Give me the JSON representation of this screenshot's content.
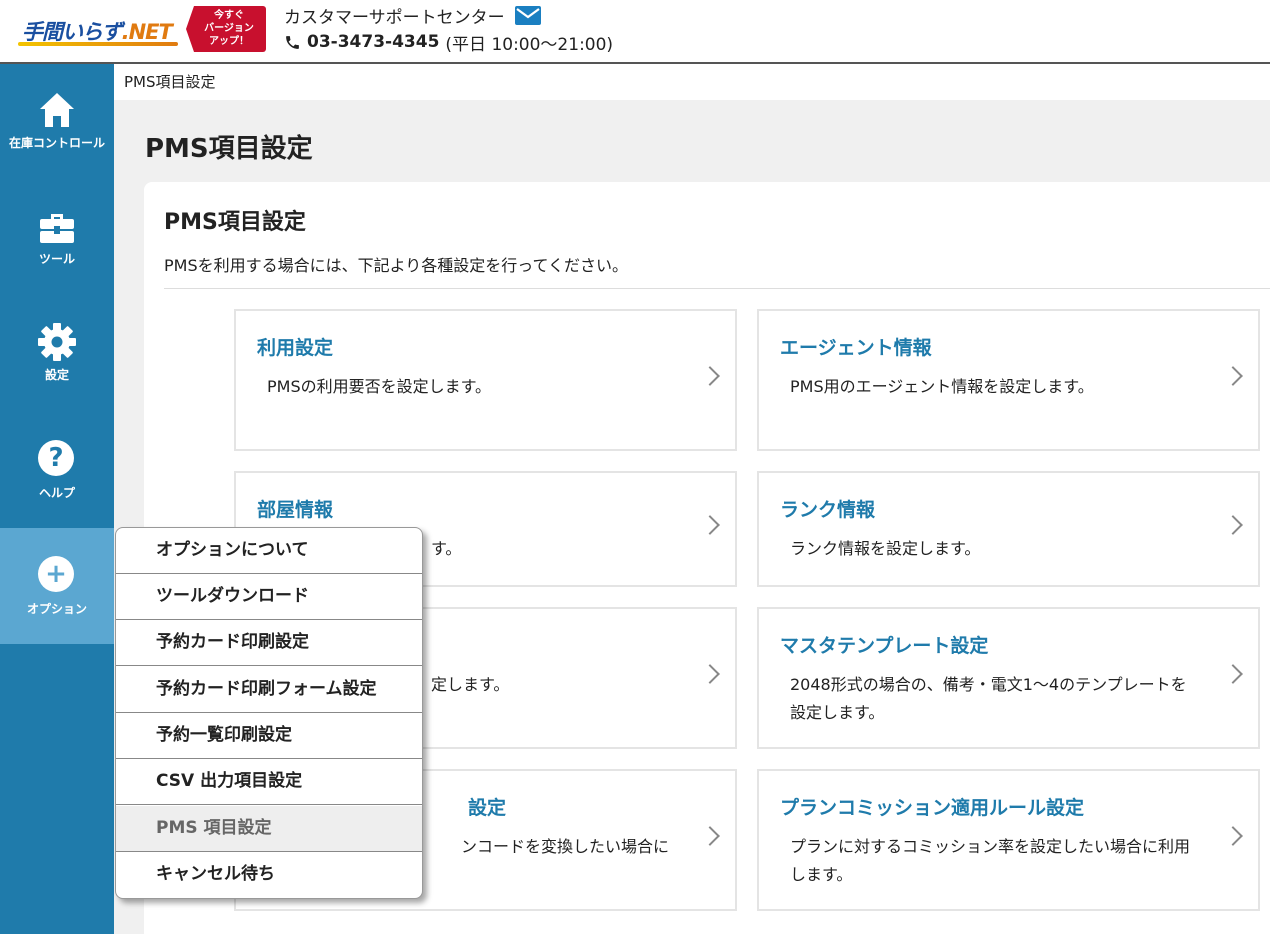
{
  "header": {
    "logo_main": "手間いらず",
    "logo_suffix": ".NET",
    "upgrade_badge": [
      "今すぐ",
      "バージョン",
      "アップ！"
    ],
    "support_title": "カスタマーサポートセンター",
    "phone_number": "03-3473-4345",
    "phone_hours": "(平日 10:00〜21:00)"
  },
  "sidebar": {
    "items": [
      {
        "label": "在庫コントロール",
        "icon": "home-icon"
      },
      {
        "label": "ツール",
        "icon": "toolbox-icon"
      },
      {
        "label": "設定",
        "icon": "gear-icon"
      },
      {
        "label": "ヘルプ",
        "icon": "help-icon",
        "glyph": "?"
      },
      {
        "label": "オプション",
        "icon": "plus-icon",
        "glyph": "+"
      }
    ]
  },
  "breadcrumb": "PMS項目設定",
  "page_title": "PMS項目設定",
  "card": {
    "title": "PMS項目設定",
    "description": "PMSを利用する場合には、下記より各種設定を行ってください。"
  },
  "tiles": [
    {
      "title": "利用設定",
      "desc": "PMSの利用要否を設定します。"
    },
    {
      "title": "エージェント情報",
      "desc": "PMS用のエージェント情報を設定します。"
    },
    {
      "title": "部屋情報",
      "desc": "す。"
    },
    {
      "title": "ランク情報",
      "desc": "ランク情報を設定します。"
    },
    {
      "title": "",
      "desc": "定します。"
    },
    {
      "title": "マスタテンプレート設定",
      "desc": "2048形式の場合の、備考・電文1〜4のテンプレートを設定します。"
    },
    {
      "title": "設定",
      "desc": "ンコードを変換したい場合に"
    },
    {
      "title": "プランコミッション適用ルール設定",
      "desc": "プランに対するコミッション率を設定したい場合に利用します。"
    }
  ],
  "dropdown": {
    "items": [
      "オプションについて",
      "ツールダウンロード",
      "予約カード印刷設定",
      "予約カード印刷フォーム設定",
      "予約一覧印刷設定",
      "CSV 出力項目設定",
      "PMS 項目設定",
      "キャンセル待ち"
    ],
    "current_index": 6
  },
  "colors": {
    "sidebar": "#1f7bab",
    "sidebar_active": "#5ba7d1",
    "link": "#1f7bab",
    "badge": "#c8102e"
  }
}
